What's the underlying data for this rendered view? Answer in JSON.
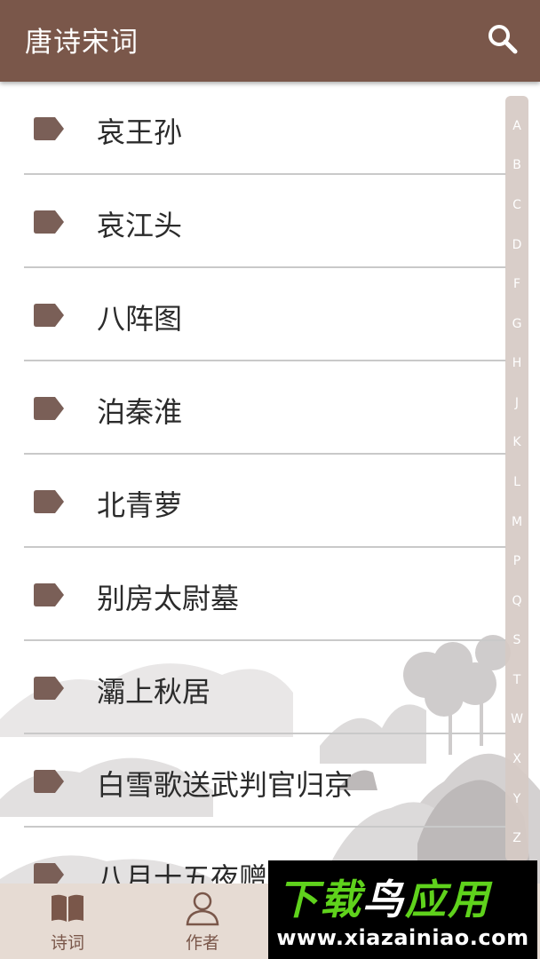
{
  "app_bar": {
    "title": "唐诗宋词",
    "search_icon": "search-icon",
    "color": "#7a574a"
  },
  "poems": [
    {
      "title": "哀王孙"
    },
    {
      "title": "哀江头"
    },
    {
      "title": "八阵图"
    },
    {
      "title": "泊秦淮"
    },
    {
      "title": "北青萝"
    },
    {
      "title": "别房太尉墓"
    },
    {
      "title": "灞上秋居"
    },
    {
      "title": "白雪歌送武判官归京"
    },
    {
      "title": "八月十五夜赠"
    }
  ],
  "index_letters": [
    "A",
    "B",
    "C",
    "D",
    "F",
    "G",
    "H",
    "J",
    "K",
    "L",
    "M",
    "P",
    "Q",
    "S",
    "T",
    "W",
    "X",
    "Y",
    "Z"
  ],
  "bottom_nav": {
    "tabs": [
      {
        "label": "诗词",
        "icon": "book-icon"
      },
      {
        "label": "作者",
        "icon": "person-icon"
      }
    ],
    "background": "#e6dbd3"
  },
  "watermark": {
    "logo_part1": "下载",
    "logo_part2": "鸟",
    "logo_part3": "应用",
    "url": "www.xiazainiao.com"
  }
}
